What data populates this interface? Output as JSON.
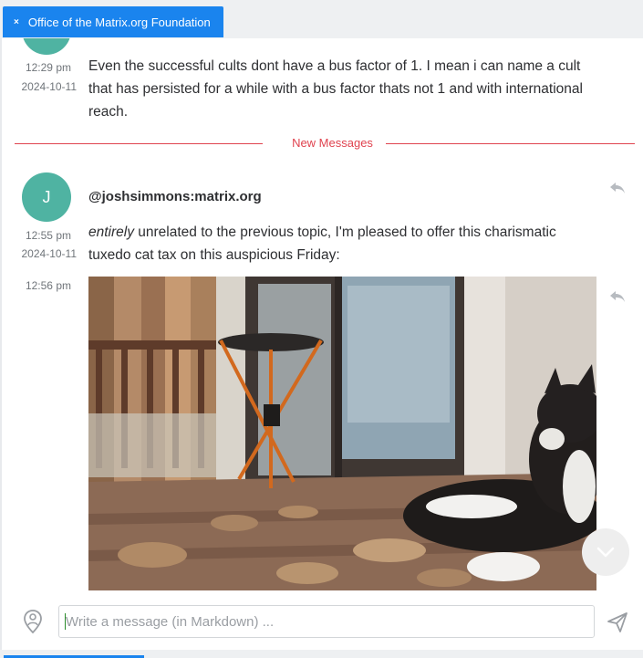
{
  "tab": {
    "close_glyph": "×",
    "title": "Office of the Matrix.org Foundation"
  },
  "messages": [
    {
      "time": "12:29 pm",
      "date": "2024-10-11",
      "text": "Even the successful cults dont have a bus factor of 1. I mean i can name a cult that has persisted for a while with a bus factor thats not 1 and with international reach."
    },
    {
      "avatar_letter": "J",
      "sender": "@joshsimmons:matrix.org",
      "time": "12:55 pm",
      "date": "2024-10-11",
      "text_emphasis": "entirely",
      "text_rest": " unrelated to the previous topic, I'm pleased to offer this charismatic tuxedo cat tax on this auspicious Friday:"
    },
    {
      "time": "12:56 pm",
      "attachment": "image"
    }
  ],
  "divider_label": "New Messages",
  "composer": {
    "placeholder": "Write a message (in Markdown) ..."
  },
  "icons": {
    "reply": "reply-icon",
    "scroll": "chevron-down-icon",
    "location": "location-pin-icon",
    "send": "send-icon"
  },
  "colors": {
    "accent": "#1a84ee",
    "avatar": "#4fb3a2",
    "new_messages": "#e0434f",
    "background": "#ffffff"
  }
}
